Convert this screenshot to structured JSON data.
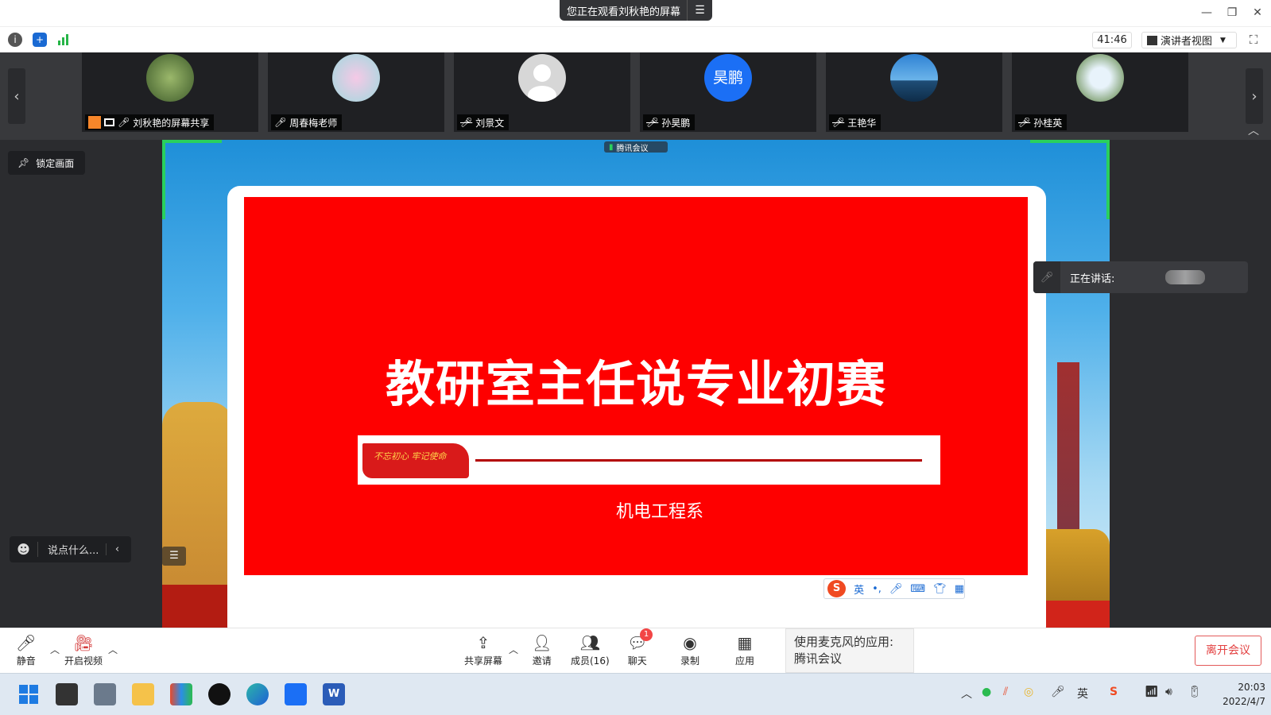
{
  "window": {
    "share_banner": "您正在观看刘秋艳的屏幕",
    "menu_icon": "menu-icon",
    "minimize_icon": "minimize-icon",
    "restore_icon": "restore-icon",
    "close_icon": "close-icon"
  },
  "infobar": {
    "timer": "41:46",
    "view_label": "演讲者视图",
    "icons": [
      "info-icon",
      "shield-icon",
      "signal-icon"
    ]
  },
  "participants": [
    {
      "name": "刘秋艳的屏幕共享",
      "mic": "on",
      "avatar_color": "#6b8a4a"
    },
    {
      "name": "周春梅老师",
      "mic": "on",
      "avatar_color": "#9fd9de"
    },
    {
      "name": "刘景文",
      "mic": "muted",
      "avatar_color": "#d7d7d7"
    },
    {
      "name": "孙昊鹏",
      "mic": "muted",
      "avatar_color": "#1b6ff5",
      "initials": "昊鹏"
    },
    {
      "name": "王艳华",
      "mic": "muted",
      "avatar_color": "#2f6ea8"
    },
    {
      "name": "孙桂英",
      "mic": "muted",
      "avatar_color": "#7a9c6a"
    }
  ],
  "stage": {
    "lock_label": "锁定画面",
    "chat_placeholder": "说点什么...",
    "speaking_label": "正在讲话:",
    "tencent_badge": "腾讯会议",
    "ime_lang": "英"
  },
  "slide": {
    "title": "教研室主任说专业初赛",
    "subtitle": "机电工程系",
    "seal_text": "不忘初心 牢记使命"
  },
  "toolbar": {
    "mute": "静音",
    "video": "开启视频",
    "share": "共享屏幕",
    "invite": "邀请",
    "members": "成员(16)",
    "chat": "聊天",
    "chat_badge": "1",
    "record": "录制",
    "apps": "应用",
    "toast_line1": "使用麦克风的应用:",
    "toast_line2": "腾讯会议",
    "leave": "离开会议"
  },
  "taskbar": {
    "time": "20:03",
    "date": "2022/4/7",
    "ime": "英",
    "colors": {
      "accent": "#1a6ad3",
      "leave": "#e34040",
      "green": "#29d05d"
    }
  }
}
